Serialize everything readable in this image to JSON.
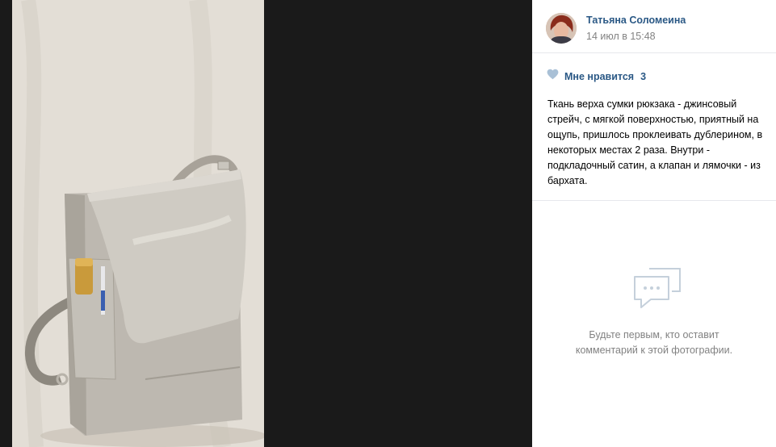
{
  "author": {
    "name": "Татьяна Соломеина",
    "date": "14 июл в 15:48"
  },
  "likes": {
    "label": "Мне нравится",
    "count": "3"
  },
  "description": "Ткань верха сумки рюкзака - джинсовый стрейч, с мягкой поверхностью, приятный на ощупь, пришлось проклеивать дублерином, в некоторых местах 2 раза. Внутри - подкладочный сатин, а клапан и лямочки - из бархата.",
  "comments": {
    "empty_text": "Будьте первым, кто оставит комментарий к этой фотографии."
  },
  "colors": {
    "link": "#2a5885",
    "muted": "#828282",
    "viewer_bg": "#1a1a1a",
    "heart": "#a9c0d6",
    "empty_icon": "#c5d0db"
  },
  "icons": {
    "like": "heart-icon",
    "comments_empty": "chat-bubbles-icon"
  }
}
